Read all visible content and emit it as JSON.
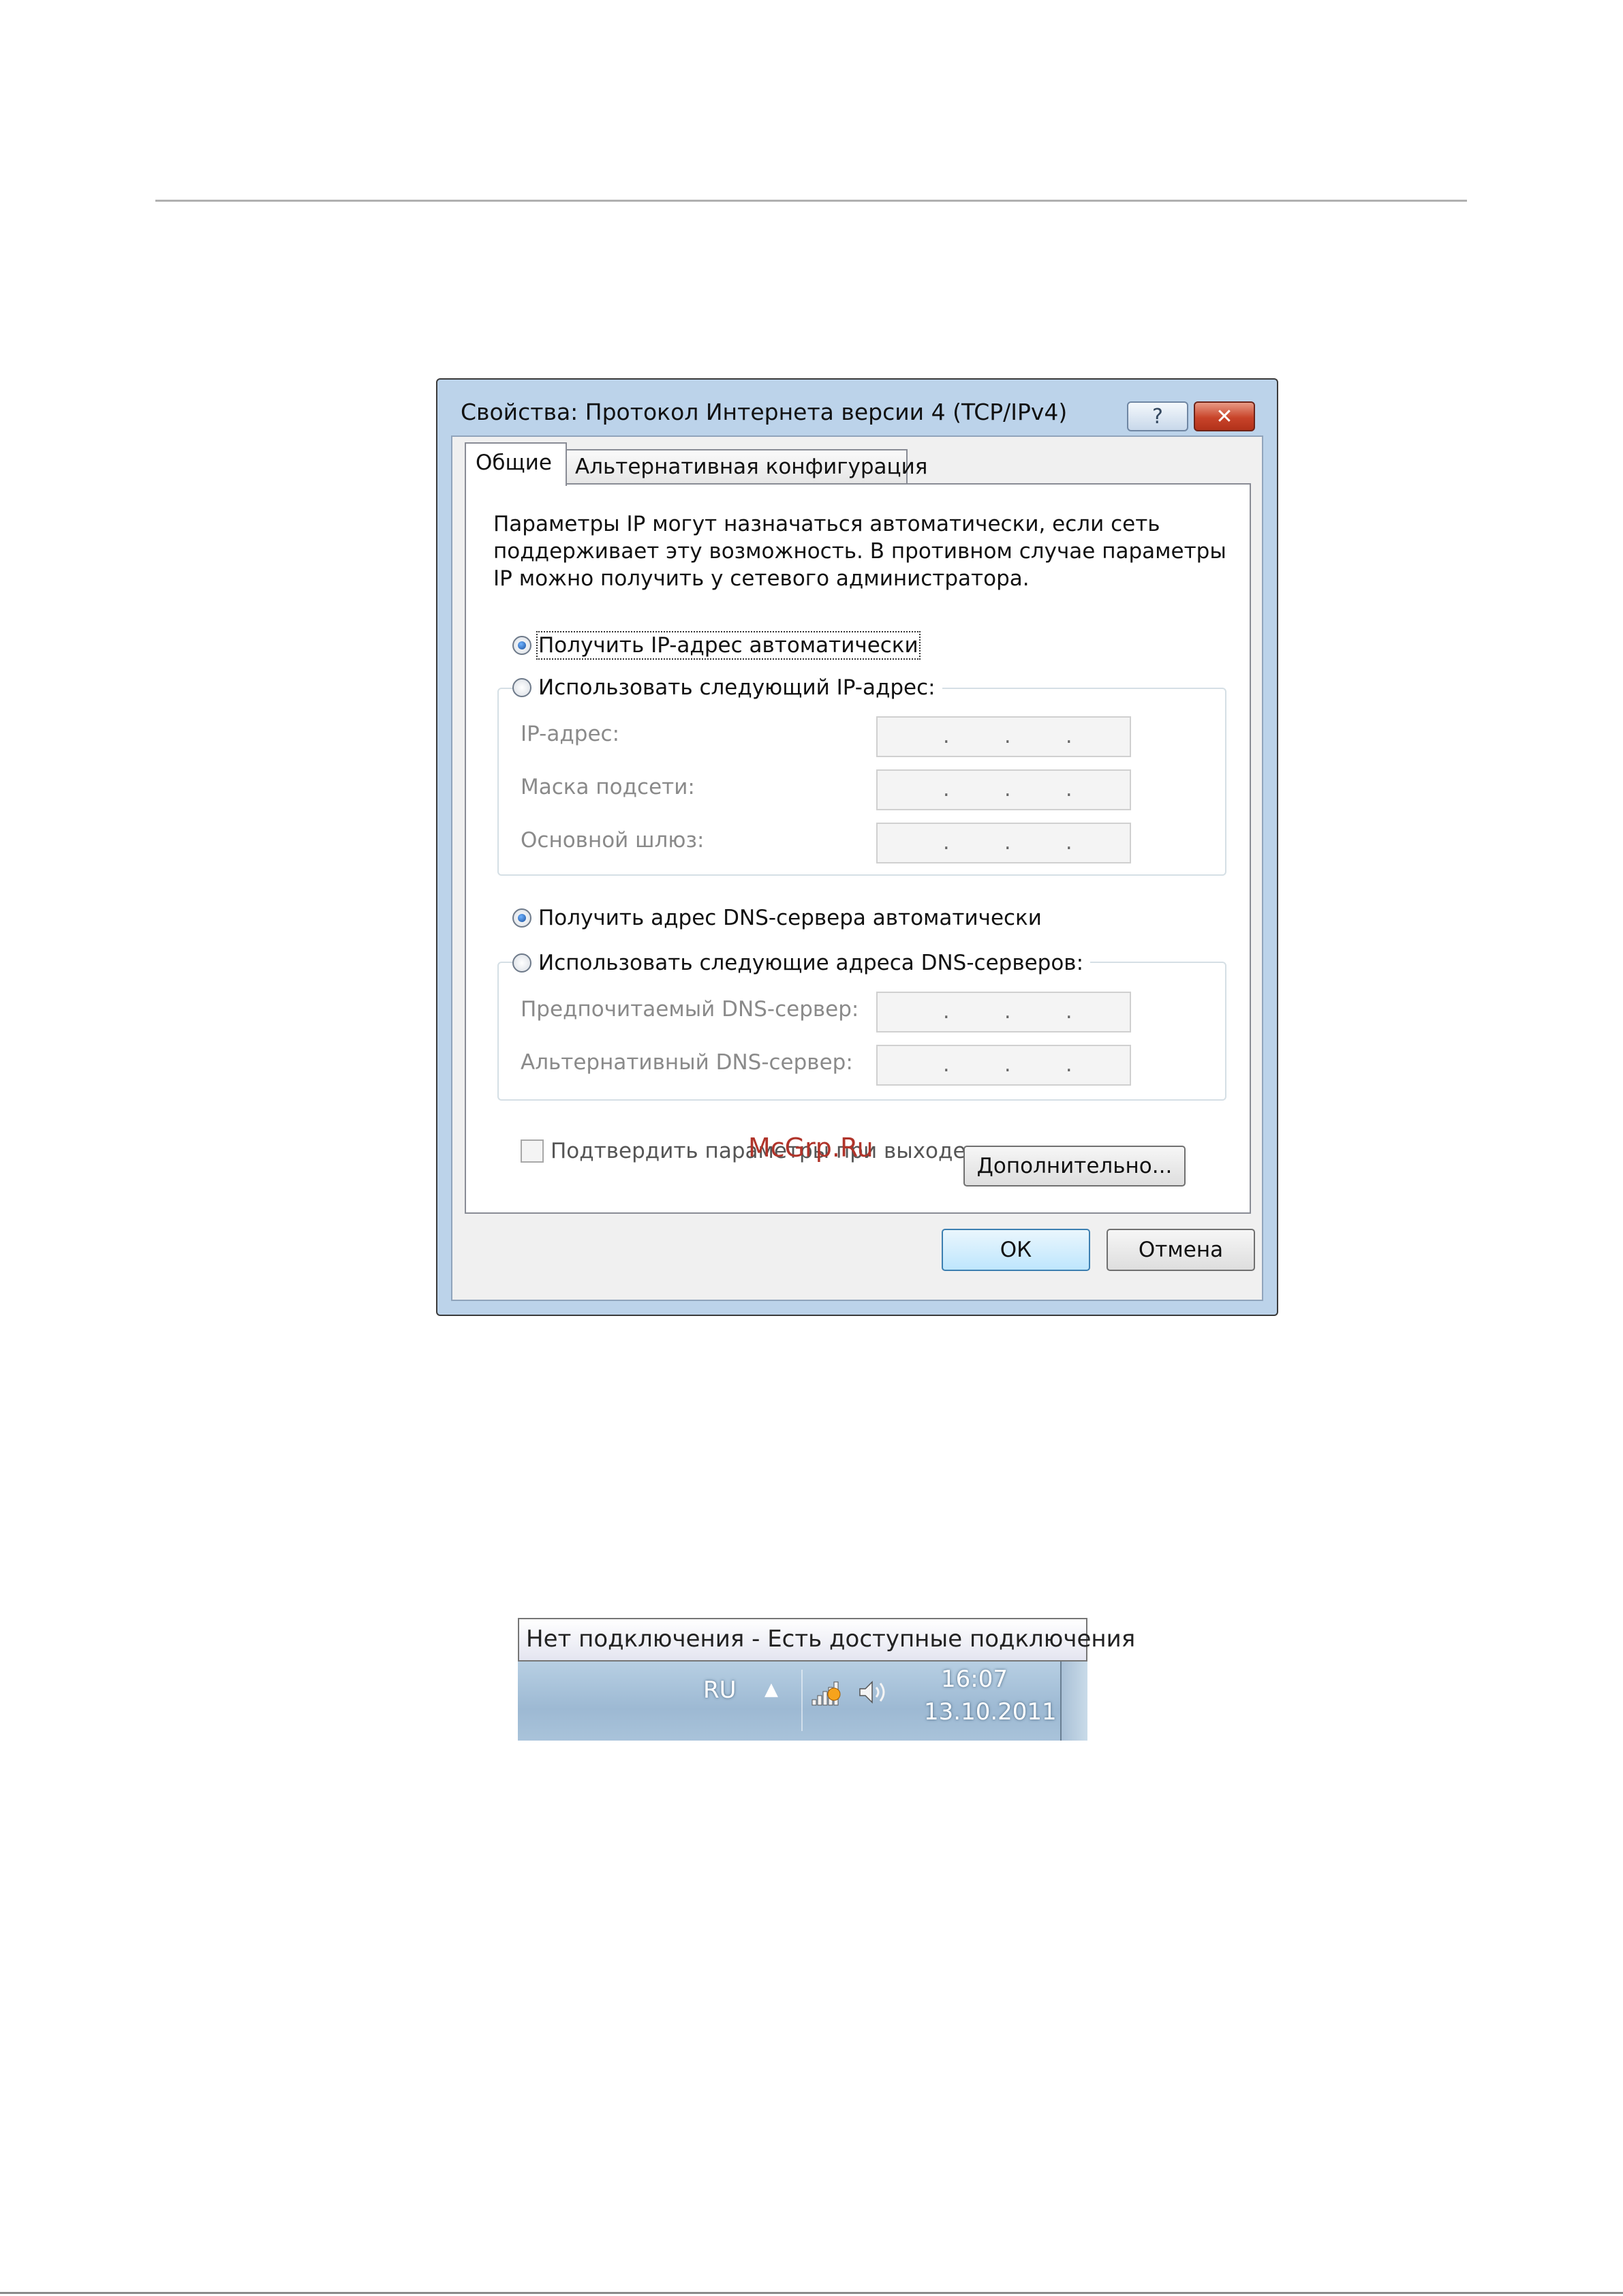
{
  "dialog": {
    "title": "Свойства: Протокол Интернета версии 4 (TCP/IPv4)",
    "help_glyph": "?",
    "close_glyph": "✕",
    "tabs": [
      {
        "label": "Общие"
      },
      {
        "label": "Альтернативная конфигурация"
      }
    ],
    "intro_lines": [
      "Параметры IP могут назначаться автоматически, если сеть",
      "поддерживает эту возможность. В противном случае параметры",
      "IP можно получить у сетевого администратора."
    ],
    "ip_auto_label": "Получить IP-адрес автоматически",
    "ip_manual_label": "Использовать следующий IP-адрес:",
    "ip_fields": [
      {
        "label": "IP-адрес:",
        "value": " .  .  . "
      },
      {
        "label": "Маска подсети:",
        "value": " .  .  . "
      },
      {
        "label": "Основной шлюз:",
        "value": " .  .  . "
      }
    ],
    "dns_auto_label": "Получить адрес DNS-сервера автоматически",
    "dns_manual_label": "Использовать следующие адреса DNS-серверов:",
    "dns_fields": [
      {
        "label": "Предпочитаемый DNS-сервер:"
      },
      {
        "label": "Альтернативный DNS-сервер:"
      }
    ],
    "confirm_label": "Подтвердить параметры при выходе",
    "advanced_label": "Дополнительно...",
    "ok_label": "ОК",
    "cancel_label": "Отмена",
    "dot": "."
  },
  "watermark": "McGrp.Ru",
  "taskbar": {
    "tooltip": "Нет подключения - Есть доступные подключения",
    "language": "RU",
    "arrow": "▲",
    "time": "16:07",
    "date": "13.10.2011",
    "icons": [
      "network-warning-icon",
      "speaker-icon"
    ]
  }
}
